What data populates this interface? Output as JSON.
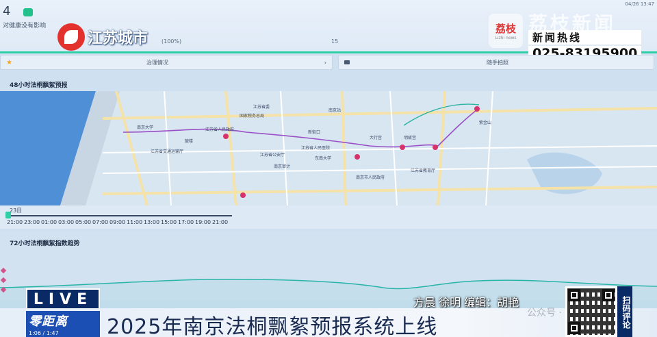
{
  "top": {
    "value": "4",
    "note": "对健康没有影响",
    "percent": "(100%)",
    "number": "15",
    "date": "04/26 13:47"
  },
  "overlay": {
    "jscity_label": "江苏城市",
    "lizhi_logo": "荔枝",
    "lizhi_logo_en": "Lizhi news",
    "lizhi_title": "荔枝新闻",
    "hotline_label": "新闻热线",
    "hotline_number": "025-83195900",
    "live": "LIVE",
    "credits": "方晨 徐明 编辑：胡艳",
    "show_name": "零距离",
    "clock": "1:06 / 1:47",
    "headline": "2025年南京法桐飘絮预报系统上线",
    "watermark": "公众号 · 南京",
    "scan_label": "扫码评论"
  },
  "controls": {
    "left_label": "治理情况",
    "left_chevron": "›",
    "right_label": "随手拍照"
  },
  "section_48": {
    "title": "48小时法桐飘絮预报",
    "day": "23日",
    "ticks": [
      "21:00",
      "23:00",
      "01:00",
      "03:00",
      "05:00",
      "07:00",
      "09:00",
      "11:00",
      "13:00",
      "15:00",
      "17:00",
      "19:00",
      "21:00"
    ]
  },
  "map": {
    "labels": [
      "江苏省人民政府",
      "江苏省委",
      "国家税务总局",
      "南京大学",
      "新街口",
      "大行宫",
      "江苏省人民医院",
      "明故宫",
      "紫金山",
      "南京站",
      "鼓楼",
      "江苏省公安厅",
      "南京审计",
      "东南大学",
      "江苏省交通运输厅",
      "南京市人民政府",
      "江苏省教育厅"
    ]
  },
  "section_72": {
    "title": "72小时法桐飘絮指数趋势"
  },
  "icons": {
    "star": "star-icon",
    "pin": "map-pin-icon",
    "logo": "jscity-logo-icon"
  },
  "colors": {
    "accent": "#2ecfa7",
    "route": "#9a4fc6",
    "pin": "#d6336c",
    "trend": "#27b5a8",
    "live_bg": "#0a2a66"
  }
}
